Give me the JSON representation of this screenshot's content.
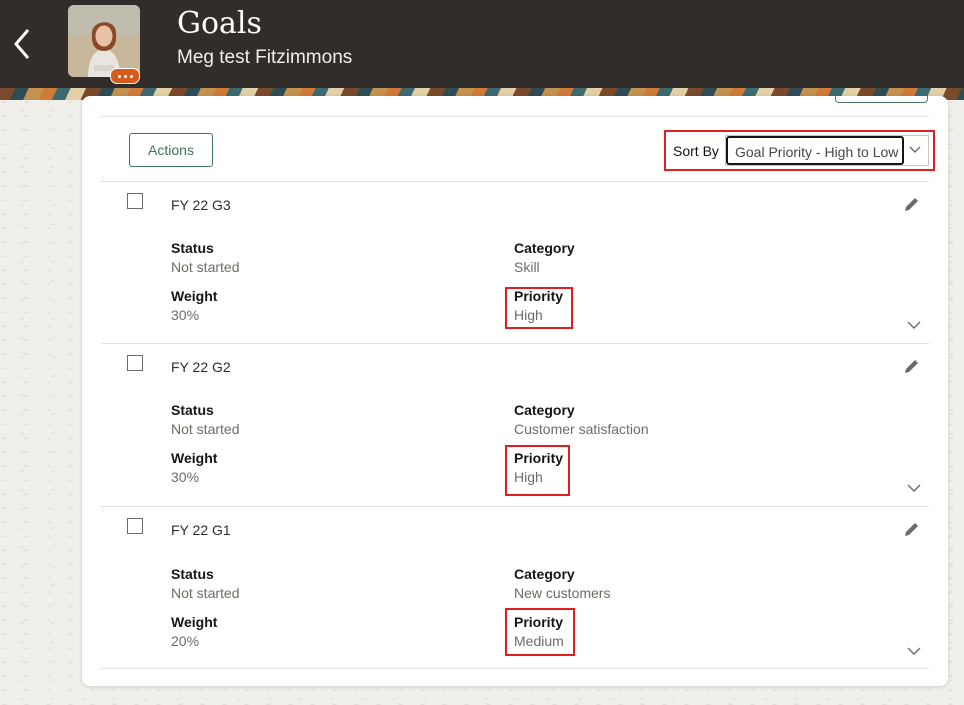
{
  "header": {
    "title": "Goals",
    "subtitle": "Meg test Fitzimmons"
  },
  "toolbar": {
    "actions_label": "Actions",
    "sort_label": "Sort By",
    "sort_value": "Goal Priority - High to Low"
  },
  "labels": {
    "status": "Status",
    "category": "Category",
    "weight": "Weight",
    "priority": "Priority"
  },
  "goals": [
    {
      "name": "FY 22 G3",
      "status": "Not started",
      "category": "Skill",
      "weight": "30%",
      "priority": "High"
    },
    {
      "name": "FY 22 G2",
      "status": "Not started",
      "category": "Customer satisfaction",
      "weight": "30%",
      "priority": "High"
    },
    {
      "name": "FY 22 G1",
      "status": "Not started",
      "category": "New customers",
      "weight": "20%",
      "priority": "Medium"
    }
  ],
  "colors": {
    "header_bg": "#312d2a",
    "accent_green": "#3f7454",
    "highlight_red": "#e02020",
    "avatar_badge": "#d95b1c"
  }
}
